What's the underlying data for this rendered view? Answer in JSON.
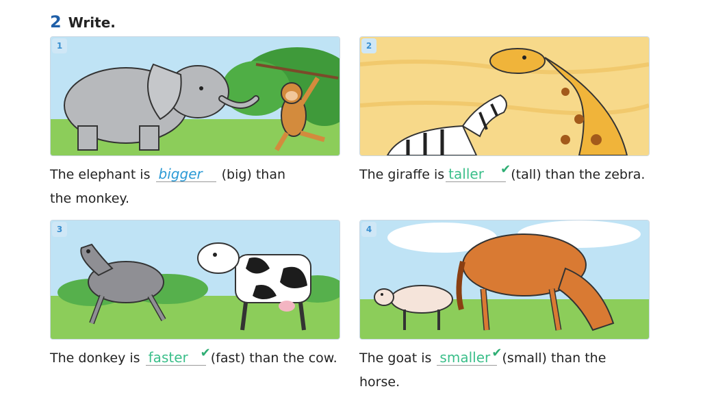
{
  "heading": {
    "number": "2",
    "title": "Write."
  },
  "exercises": [
    {
      "badge": "1",
      "before": "The elephant is",
      "answer": "bigger",
      "after": "(big) than",
      "line2": "the monkey.",
      "animals": [
        "elephant",
        "monkey"
      ]
    },
    {
      "badge": "2",
      "before": "The giraffe is",
      "answer": "taller",
      "after": "(tall) than the zebra.",
      "animals": [
        "giraffe",
        "zebra"
      ]
    },
    {
      "badge": "3",
      "before": "The donkey is",
      "answer": "faster",
      "after": "(fast) than the cow.",
      "animals": [
        "donkey",
        "cow"
      ]
    },
    {
      "badge": "4",
      "before": "The goat is",
      "answer": "smaller",
      "after": "(small) than the horse.",
      "animals": [
        "goat",
        "horse"
      ]
    }
  ],
  "tick_icon": "check-icon",
  "colors": {
    "heading_number": "#1f5fa8",
    "answer_blue": "#2d9bd6",
    "answer_green": "#3bbf8a",
    "tick": "#2fae74"
  }
}
